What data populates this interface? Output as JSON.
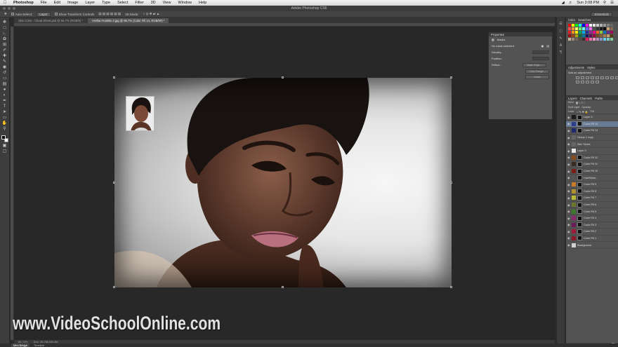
{
  "menubar": {
    "app": "Photoshop",
    "items": [
      "File",
      "Edit",
      "Image",
      "Layer",
      "Type",
      "Select",
      "Filter",
      "3D",
      "View",
      "Window",
      "Help"
    ],
    "clock": "Sun 3:08 PM"
  },
  "titlebar": {
    "title": "Adobe Photoshop CS6"
  },
  "options": {
    "auto_select": "Auto-Select:",
    "auto_select_value": "Layer",
    "transform_controls": "Show Transform Controls",
    "mode_3d": "3D Mode:",
    "workspace": "Essentials"
  },
  "tabs": [
    {
      "label": "Skin Color - Cheat Sheet.psd @ 66.7% (RGB/8) *"
    },
    {
      "label": "Aretha Franklin 2.jpg @ 66.7% (Color Fill 14, RGB/8#) *"
    }
  ],
  "properties": {
    "header": "Properties",
    "section": "Masks",
    "no_mask": "No mask selected",
    "density": "Density:",
    "feather": "Feather:",
    "refine": "Refine:",
    "mask_edge": "Mask Edge...",
    "color_range": "Color Range...",
    "invert": "Invert"
  },
  "panels": {
    "color_tab": "Color",
    "swatches_tab": "Swatches",
    "adjustments_tab": "Adjustments",
    "styles_tab": "Styles",
    "add_adjustment": "Add an adjustment",
    "layers_tab": "Layers",
    "channels_tab": "Channels",
    "paths_tab": "Paths",
    "kind": "Kind",
    "blend": "Soft Light",
    "opacity": "Opacity:",
    "lock": "Lock:",
    "fill": "Fill:"
  },
  "swatch_colors": [
    "#ff0000",
    "#ffff00",
    "#00ff00",
    "#00ffff",
    "#0000ff",
    "#ff00ff",
    "#ffffff",
    "#e6e6e6",
    "#cccccc",
    "#b3b3b3",
    "#999999",
    "#808080",
    "#666666",
    "#ff4d4d",
    "#ff9933",
    "#ffff66",
    "#66ff66",
    "#66ffff",
    "#6666ff",
    "#ff66ff",
    "#4d4d4d",
    "#333333",
    "#1a1a1a",
    "#000000",
    "#c8a07a",
    "#8c6a4a",
    "#ee1c24",
    "#f7941d",
    "#fff200",
    "#00a651",
    "#00aeef",
    "#2e3192",
    "#92278f",
    "#ec008c",
    "#f26522",
    "#8dc63f",
    "#0072bc",
    "#662d91",
    "#9e005d",
    "#9e0b0f",
    "#a0410d",
    "#aba000",
    "#007236",
    "#0076a3",
    "#1b1464",
    "#630460",
    "#9e0039",
    "#754c24",
    "#8c6239",
    "#a67c52",
    "#c69c6d",
    "#603913",
    "#c7b299",
    "#998675",
    "#736357",
    "#534741",
    "#362f2d",
    "#ed145b",
    "#f06eaa",
    "#f49ac2",
    "#bd8cbf",
    "#8493ca",
    "#6dcff6",
    "#7accc8",
    "#82ca9c"
  ],
  "layers": [
    {
      "name": "Layer 4",
      "color": "#1a1a1a",
      "mask": true,
      "selected": false
    },
    {
      "name": "Color Fill 14",
      "color": "#2a3c8a",
      "mask": true,
      "selected": true
    },
    {
      "name": "Color Fill 13",
      "color": "#1b2a70",
      "mask": true,
      "selected": false
    },
    {
      "name": "Group 2 copy",
      "color": "",
      "mask": false,
      "selected": false
    },
    {
      "name": "Skin Tones",
      "color": "",
      "mask": false,
      "selected": false
    },
    {
      "name": "Layer 3",
      "color": "#e8e8e8",
      "mask": false,
      "selected": false
    },
    {
      "name": "Color Fill 12",
      "color": "#8a4b1c",
      "mask": true,
      "selected": false
    },
    {
      "name": "Color Fill 11",
      "color": "#3a2b20",
      "mask": true,
      "selected": false
    },
    {
      "name": "Color Fill 10",
      "color": "#7a1f16",
      "mask": true,
      "selected": false
    },
    {
      "name": "Hue/Satur...",
      "color": "#555555",
      "mask": true,
      "selected": false
    },
    {
      "name": "Color Fill 9",
      "color": "#c97a2a",
      "mask": true,
      "selected": false
    },
    {
      "name": "Color Fill 8",
      "color": "#b0902a",
      "mask": true,
      "selected": false
    },
    {
      "name": "Color Fill 7",
      "color": "#b8b832",
      "mask": true,
      "selected": false
    },
    {
      "name": "Color Fill 6",
      "color": "#6a7a2a",
      "mask": true,
      "selected": false
    },
    {
      "name": "Color Fill 5",
      "color": "#3a7a2a",
      "mask": true,
      "selected": false
    },
    {
      "name": "Color Fill 4",
      "color": "#8a2a6a",
      "mask": true,
      "selected": false
    },
    {
      "name": "Color Fill 3",
      "color": "#6a1a5a",
      "mask": true,
      "selected": false
    },
    {
      "name": "Color Fill 2",
      "color": "#a01a3a",
      "mask": true,
      "selected": false
    },
    {
      "name": "Color Fill 1",
      "color": "#8a1a2a",
      "mask": true,
      "selected": false
    },
    {
      "name": "Background",
      "color": "#cfcfcf",
      "mask": false,
      "selected": false
    }
  ],
  "status": {
    "zoom": "66.74%",
    "doc": "Doc: 25.7M/155.4M"
  },
  "bottom_tabs": [
    "Mini Bridge",
    "Timeline"
  ],
  "watermark": "www.VideoSchoolOnline.com"
}
